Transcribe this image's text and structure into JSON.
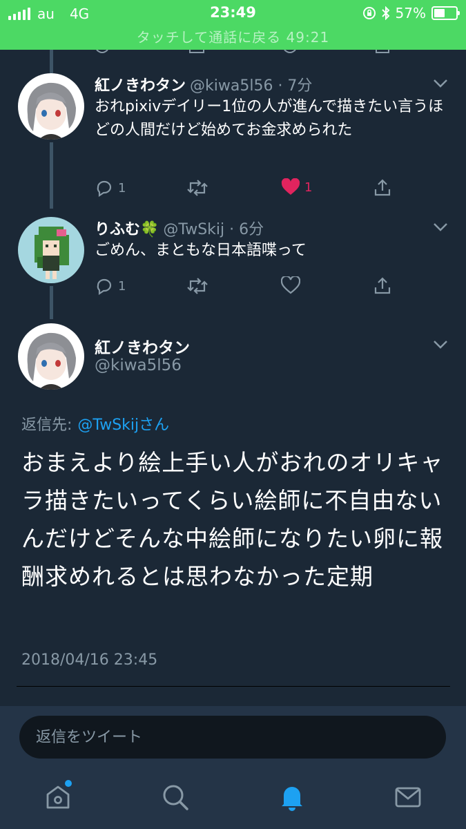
{
  "status_bar": {
    "carrier": "au",
    "network": "4G",
    "time": "23:49",
    "battery": "57%",
    "battery_level": 0.57,
    "banner": "タッチして通話に戻る 49:21"
  },
  "tweets": [
    {
      "display_name": "紅ノきわタン",
      "handle_time": "@kiwa5l56 · 7分",
      "text": "おれpixivデイリー1位の人が進んで描きたい言うほどの人間だけど始めてお金求められた",
      "reply_count": "1",
      "like_count": "1",
      "liked": true
    },
    {
      "display_name": "りふむ🍀",
      "handle_time": "@TwSkij · 6分",
      "text": "ごめん、まともな日本語喋って",
      "reply_count": "1",
      "liked": false
    }
  ],
  "main_tweet": {
    "display_name": "紅ノきわタン",
    "handle": "@kiwa5l56",
    "reply_to_label": "返信先:",
    "reply_to_user": "@TwSkijさん",
    "text": "おまえより絵上手い人がおれのオリキャラ描きたいってくらい絵師に不自由ないんだけどそんな中絵師になりたい卵に報酬求めれるとは思わなかった定期",
    "timestamp": "2018/04/16 23:45"
  },
  "reply_bar": {
    "placeholder": "返信をツイート"
  },
  "tab_bar": {
    "items": [
      "home-icon",
      "search-icon",
      "notifications-icon",
      "messages-icon"
    ],
    "active": "notifications-icon"
  },
  "colors": {
    "background": "#1b2836",
    "accent": "#1da1f2",
    "like": "#e0245e",
    "call_banner": "#4cd964",
    "muted_text": "#8899a6"
  }
}
